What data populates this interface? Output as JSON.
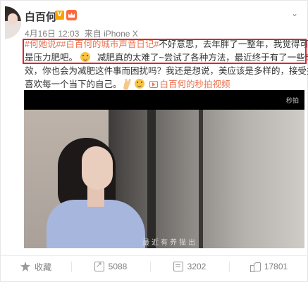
{
  "post": {
    "author": "白百何",
    "verified_badge": "V",
    "timestamp": "4月16日 12:03",
    "source": "来自 iPhone X",
    "text": {
      "line1_link": "#何她说##白百何的城市声音日记#",
      "line1_rest": "不好意思，去年胖了一整年，我觉得可能",
      "line2_a": "是压力肥吧。",
      "line2_b": "减肥真的太难了~尝试了各种方法，最近终于有了一些成",
      "line3": "效，你也会为减肥这件事而困扰吗？我还是想说，美应该是多样的，接受并",
      "line4": "喜欢每一个当下的自己。",
      "video_link": "白百何的秒拍视频"
    },
    "video": {
      "watermark": "秒拍",
      "subtitle": "最近有养猫出"
    }
  },
  "actions": {
    "favorite": "收藏",
    "repost": "5088",
    "comment": "3202",
    "like": "17801"
  },
  "colors": {
    "link": "#eb7350",
    "highlight": "#e0232d",
    "meta_text": "#808080"
  },
  "icons": [
    "avatar",
    "verified-badge",
    "member-crown-icon",
    "chevron-down-icon",
    "emoji-smile-icon",
    "victory-hand-icon",
    "video-icon",
    "star-icon",
    "share-icon",
    "comment-icon",
    "like-icon"
  ]
}
